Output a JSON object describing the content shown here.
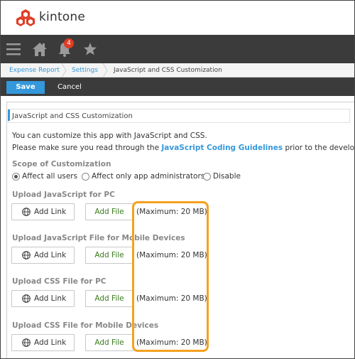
{
  "app": {
    "brand": "kintone"
  },
  "nav": {
    "notification_count": "4"
  },
  "breadcrumb": {
    "items": [
      "Expense Report",
      "Settings",
      "JavaScript and CSS Customization"
    ]
  },
  "toolbar": {
    "save_label": "Save",
    "cancel_label": "Cancel"
  },
  "panel": {
    "title": "JavaScript and CSS Customization",
    "desc_line1": "You can customize this app with JavaScript and CSS.",
    "desc_line2_pre": "Please make sure you read through the ",
    "desc_line2_link": "JavaScript Coding Guidelines",
    "desc_line2_post": " prior to the development.",
    "scope_label": "Scope of Customization",
    "scope_options": [
      {
        "label": "Affect all users",
        "checked": true
      },
      {
        "label": "Affect only app administrators",
        "checked": false
      },
      {
        "label": "Disable",
        "checked": false
      }
    ],
    "sections": [
      {
        "label": "Upload JavaScript for PC",
        "add_link": "Add Link",
        "add_file": "Add File",
        "max": "(Maximum: 20 MB)"
      },
      {
        "label": "Upload JavaScript File for Mobile Devices",
        "add_link": "Add Link",
        "add_file": "Add File",
        "max": "(Maximum: 20 MB)"
      },
      {
        "label": "Upload CSS File for PC",
        "add_link": "Add Link",
        "add_file": "Add File",
        "max": "(Maximum: 20 MB)"
      },
      {
        "label": "Upload CSS File for Mobile Devices",
        "add_link": "Add Link",
        "add_file": "Add File",
        "max": "(Maximum: 20 MB)"
      }
    ]
  },
  "colors": {
    "accent": "#3498db",
    "highlight": "#f5a11f",
    "navbar": "#3b3b3b",
    "logo": "#e03b24"
  }
}
